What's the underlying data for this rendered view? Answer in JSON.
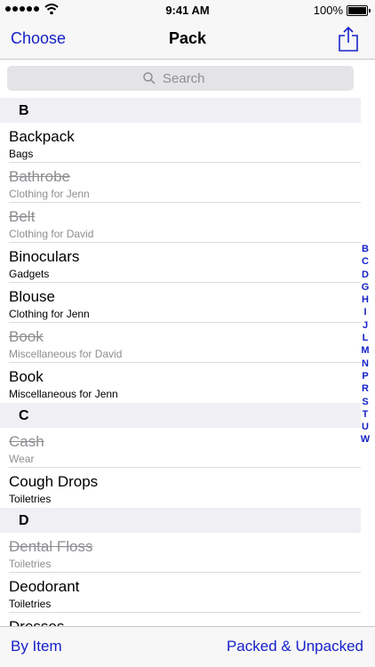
{
  "status": {
    "time": "9:41 AM",
    "battery": "100%"
  },
  "nav": {
    "left": "Choose",
    "title": "Pack"
  },
  "search": {
    "placeholder": "Search"
  },
  "sections": [
    {
      "letter": "B",
      "items": [
        {
          "title": "Backpack",
          "subtitle": "Bags",
          "packed": false
        },
        {
          "title": "Bathrobe",
          "subtitle": "Clothing for Jenn",
          "packed": true
        },
        {
          "title": "Belt",
          "subtitle": "Clothing for David",
          "packed": true
        },
        {
          "title": "Binoculars",
          "subtitle": "Gadgets",
          "packed": false
        },
        {
          "title": "Blouse",
          "subtitle": "Clothing for Jenn",
          "packed": false
        },
        {
          "title": "Book",
          "subtitle": "Miscellaneous for David",
          "packed": true
        },
        {
          "title": "Book",
          "subtitle": "Miscellaneous for Jenn",
          "packed": false
        }
      ]
    },
    {
      "letter": "C",
      "items": [
        {
          "title": "Cash",
          "subtitle": "Wear",
          "packed": true
        },
        {
          "title": "Cough Drops",
          "subtitle": "Toiletries",
          "packed": false
        }
      ]
    },
    {
      "letter": "D",
      "items": [
        {
          "title": "Dental Floss",
          "subtitle": "Toiletries",
          "packed": true
        },
        {
          "title": "Deodorant",
          "subtitle": "Toiletries",
          "packed": false
        },
        {
          "title": "Dresses",
          "subtitle": "",
          "packed": false
        }
      ]
    }
  ],
  "index": [
    "B",
    "C",
    "D",
    "G",
    "H",
    "I",
    "J",
    "L",
    "M",
    "N",
    "P",
    "R",
    "S",
    "T",
    "U",
    "W"
  ],
  "toolbar": {
    "left": "By Item",
    "right": "Packed & Unpacked"
  },
  "colors": {
    "accent": "#1621c9",
    "packed_text": "#8e8e93",
    "section_bg": "#efeff4"
  }
}
